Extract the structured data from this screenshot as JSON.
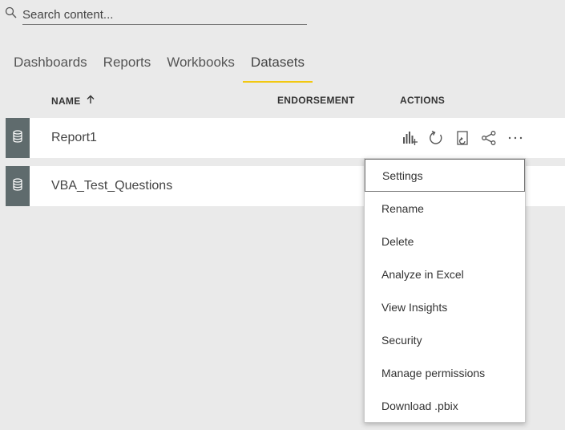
{
  "search": {
    "placeholder": "Search content...",
    "icon": "search-icon"
  },
  "tabs": [
    {
      "label": "Dashboards",
      "active": false
    },
    {
      "label": "Reports",
      "active": false
    },
    {
      "label": "Workbooks",
      "active": false
    },
    {
      "label": "Datasets",
      "active": true
    }
  ],
  "table": {
    "headers": {
      "name": "NAME",
      "endorsement": "ENDORSEMENT",
      "actions": "ACTIONS"
    },
    "sort_icon": "arrow-up-icon",
    "rows": [
      {
        "name": "Report1",
        "icon": "database-icon"
      },
      {
        "name": "VBA_Test_Questions",
        "icon": "database-icon"
      }
    ],
    "action_icons": [
      "create-report-icon",
      "refresh-icon",
      "schedule-refresh-icon",
      "share-icon",
      "more-options-icon"
    ]
  },
  "context_menu": {
    "items": [
      {
        "label": "Settings"
      },
      {
        "label": "Rename"
      },
      {
        "label": "Delete"
      },
      {
        "label": "Analyze in Excel"
      },
      {
        "label": "View Insights"
      },
      {
        "label": "Security"
      },
      {
        "label": "Manage permissions"
      },
      {
        "label": "Download .pbix"
      }
    ]
  },
  "colors": {
    "background": "#eaeaea",
    "row_strip": "#5f6b6d",
    "active_tab_underline": "#f2c811"
  }
}
